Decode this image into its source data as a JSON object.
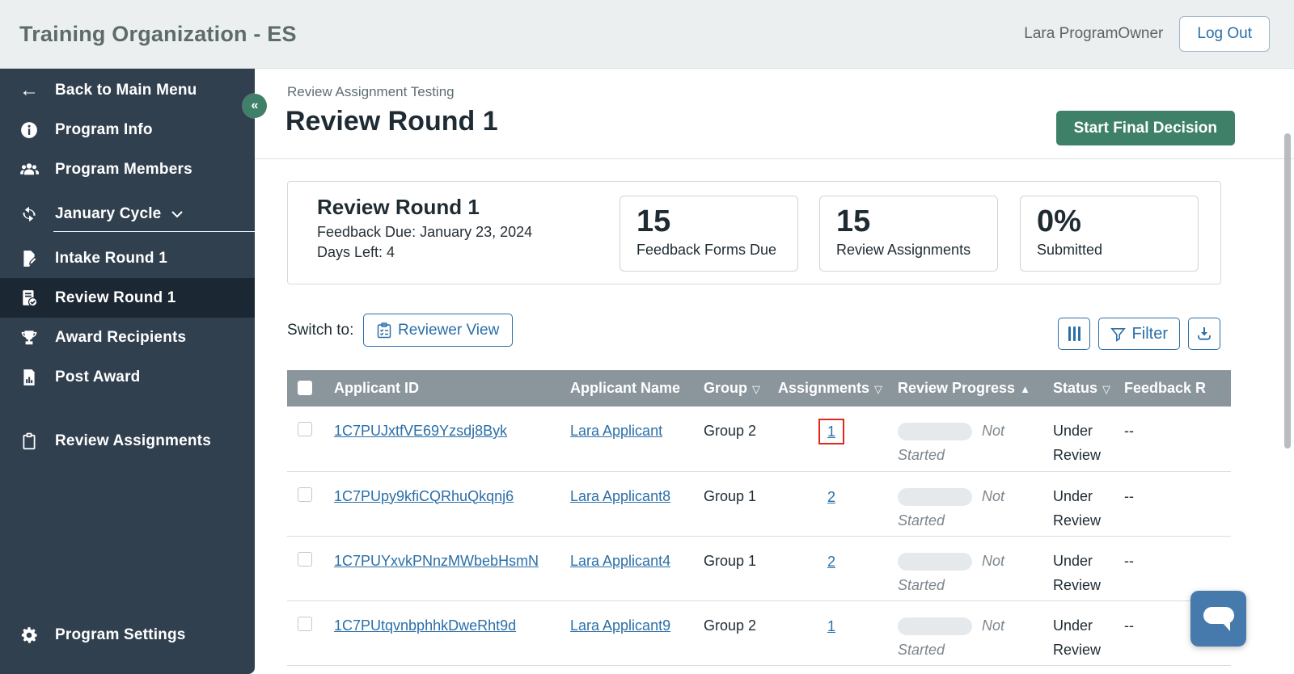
{
  "header": {
    "title": "Training Organization - ES",
    "user_name": "Lara ProgramOwner",
    "logout_label": "Log Out"
  },
  "sidebar": {
    "items": [
      {
        "label": "Back to Main Menu",
        "icon": "arrow-left-icon"
      },
      {
        "label": "Program Info",
        "icon": "info-icon"
      },
      {
        "label": "Program Members",
        "icon": "people-icon"
      },
      {
        "label": "January Cycle",
        "icon": "cycle-icon",
        "has_chevron": true
      },
      {
        "label": "Intake Round 1",
        "icon": "document-edit-icon"
      },
      {
        "label": "Review Round 1",
        "icon": "document-check-icon",
        "active": true
      },
      {
        "label": "Award Recipients",
        "icon": "trophy-icon"
      },
      {
        "label": "Post Award",
        "icon": "document-chart-icon"
      },
      {
        "label": "Review Assignments",
        "icon": "clipboard-icon"
      }
    ],
    "bottom_item": {
      "label": "Program Settings",
      "icon": "gear-icon"
    }
  },
  "page": {
    "breadcrumb": "Review Assignment Testing",
    "title": "Review Round 1",
    "primary_action": "Start Final Decision"
  },
  "summary": {
    "round_title": "Review Round 1",
    "feedback_due": "Feedback Due: January 23, 2024",
    "days_left": "Days Left: 4",
    "stats": [
      {
        "value": "15",
        "label": "Feedback Forms Due"
      },
      {
        "value": "15",
        "label": "Review Assignments"
      },
      {
        "value": "0%",
        "label": "Submitted"
      }
    ]
  },
  "toolbar": {
    "switch_label": "Switch to:",
    "reviewer_view_label": "Reviewer View",
    "filter_label": "Filter"
  },
  "table": {
    "columns": [
      "Applicant ID",
      "Applicant Name",
      "Group",
      "Assignments",
      "Review Progress",
      "Status",
      "Feedback R"
    ],
    "rows": [
      {
        "applicant_id": "1C7PUJxtfVE69Yzsdj8Byk",
        "applicant_name": "Lara Applicant",
        "group": "Group 2",
        "assignments": "1",
        "progress_label": "Not Started",
        "status": "Under Review",
        "feedback": "--",
        "highlighted": true
      },
      {
        "applicant_id": "1C7PUpy9kfiCQRhuQkqnj6",
        "applicant_name": "Lara Applicant8",
        "group": "Group 1",
        "assignments": "2",
        "progress_label": "Not Started",
        "status": "Under Review",
        "feedback": "--",
        "highlighted": false
      },
      {
        "applicant_id": "1C7PUYxvkPNnzMWbebHsmN",
        "applicant_name": "Lara Applicant4",
        "group": "Group 1",
        "assignments": "2",
        "progress_label": "Not Started",
        "status": "Under Review",
        "feedback": "--",
        "highlighted": false
      },
      {
        "applicant_id": "1C7PUtqvnbphhkDweRht9d",
        "applicant_name": "Lara Applicant9",
        "group": "Group 2",
        "assignments": "1",
        "progress_label": "Not Started",
        "status": "Under Review",
        "feedback": "--",
        "highlighted": false
      }
    ]
  },
  "icons": {
    "collapse": "«",
    "sort_down": "▽",
    "sort_up": "▲",
    "back_arrow": "←"
  },
  "colors": {
    "accent-green": "#3e8168",
    "link-blue": "#2a6fa8",
    "sidebar-bg": "#31404f",
    "sidebar-active-bg": "#1b2733",
    "header-bg": "#eceff0",
    "table-header-bg": "#8b959c",
    "annotation-red": "#e0281e",
    "chat-blue": "#477aac"
  }
}
